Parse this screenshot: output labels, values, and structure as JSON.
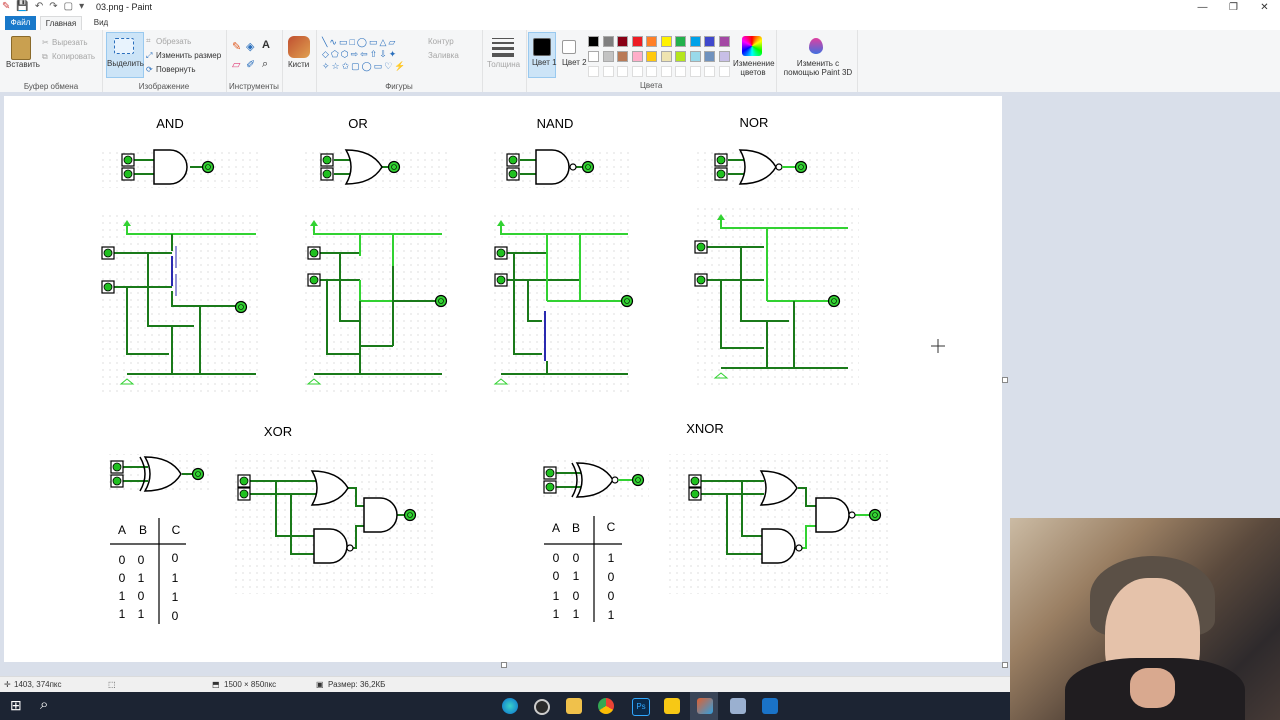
{
  "window": {
    "title": "03.png - Paint",
    "min": "—",
    "max": "❐",
    "close": "✕"
  },
  "tabs": {
    "file": "Файл",
    "home": "Главная",
    "view": "Вид"
  },
  "ribbon": {
    "clipboard": {
      "paste": "Вставить",
      "cut": "Вырезать",
      "copy": "Копировать",
      "group": "Буфер обмена"
    },
    "image": {
      "select": "Выделить",
      "crop": "Обрезать",
      "resize": "Изменить размер",
      "rotate": "Повернуть",
      "group": "Изображение"
    },
    "tools": {
      "group": "Инструменты"
    },
    "brushes": {
      "label": "Кисти"
    },
    "shapes": {
      "outline": "Контур",
      "fill": "Заливка",
      "group": "Фигуры"
    },
    "size": {
      "label": "Толщина"
    },
    "colors": {
      "color1": "Цвет 1",
      "color2": "Цвет 2",
      "edit": "Изменение цветов",
      "paint3d": "Изменить с помощью Paint 3D",
      "group": "Цвета",
      "palette": [
        "#000000",
        "#7f7f7f",
        "#880015",
        "#ed1c24",
        "#ff7f27",
        "#fff200",
        "#22b14c",
        "#00a2e8",
        "#3f48cc",
        "#a349a4",
        "#ffffff",
        "#c3c3c3",
        "#b97a57",
        "#ffaec9",
        "#ffc90e",
        "#efe4b0",
        "#b5e61d",
        "#99d9ea",
        "#7092be",
        "#c8bfe7"
      ]
    }
  },
  "canvas": {
    "gates": {
      "and": "AND",
      "or": "OR",
      "nand": "NAND",
      "nor": "NOR",
      "xor": "XOR",
      "xnor": "XNOR"
    },
    "pin_value": "0",
    "xor_table": {
      "headers": [
        "A",
        "B",
        "C"
      ],
      "rows": [
        [
          "0",
          "0",
          "0"
        ],
        [
          "0",
          "1",
          "1"
        ],
        [
          "1",
          "0",
          "1"
        ],
        [
          "1",
          "1",
          "0"
        ]
      ]
    },
    "xnor_table": {
      "headers": [
        "A",
        "B",
        "C"
      ],
      "rows": [
        [
          "0",
          "0",
          "1"
        ],
        [
          "0",
          "1",
          "0"
        ],
        [
          "1",
          "0",
          "0"
        ],
        [
          "1",
          "1",
          "1"
        ]
      ]
    }
  },
  "status": {
    "cursor": "1403, 374пкс",
    "dimensions": "1500 × 850пкс",
    "size": "Размер: 36,2КБ"
  }
}
